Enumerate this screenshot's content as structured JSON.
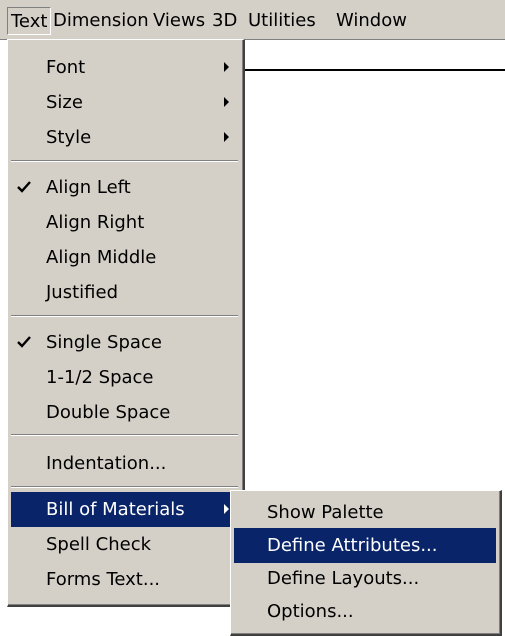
{
  "menubar": {
    "items": [
      "Text",
      "Dimension",
      "Views",
      "3D",
      "Utilities",
      "Window"
    ]
  },
  "text_menu": {
    "font": "Font",
    "size": "Size",
    "style": "Style",
    "align_left": "Align Left",
    "align_right": "Align Right",
    "align_middle": "Align Middle",
    "justified": "Justified",
    "single_space": "Single Space",
    "one_half_space": "1-1/2 Space",
    "double_space": "Double Space",
    "indentation": "Indentation...",
    "bill_of_materials": "Bill of Materials",
    "spell_check": "Spell Check",
    "forms_text": "Forms Text..."
  },
  "bom_submenu": {
    "show_palette": "Show Palette",
    "define_attributes": "Define Attributes...",
    "define_layouts": "Define Layouts...",
    "options": "Options..."
  },
  "colors": {
    "menu_face": "#d4d0c8",
    "highlight": "#0a246a",
    "highlight_text": "#ffffff"
  },
  "state": {
    "checked_items": [
      "Align Left",
      "Single Space"
    ],
    "highlighted_items": [
      "Bill of Materials",
      "Define Attributes..."
    ]
  }
}
